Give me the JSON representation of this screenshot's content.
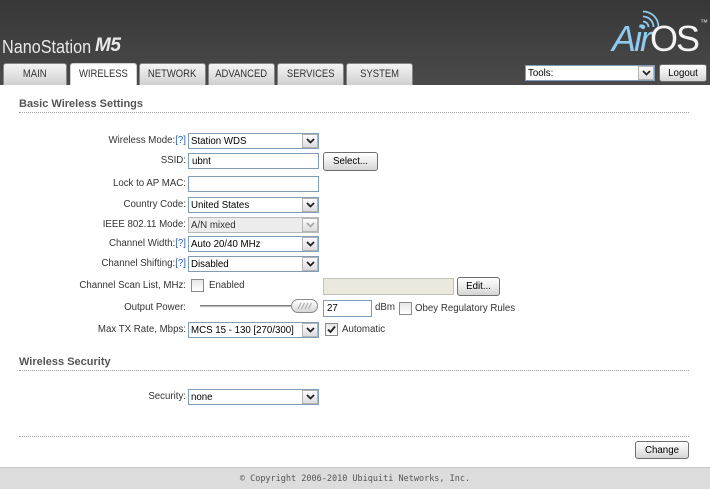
{
  "header": {
    "product_name": "NanoStation",
    "product_model": "M5",
    "brand_air": "Air",
    "brand_os": "OS",
    "brand_tm": "™"
  },
  "tabs": [
    {
      "label": "MAIN",
      "active": false
    },
    {
      "label": "WIRELESS",
      "active": true
    },
    {
      "label": "NETWORK",
      "active": false
    },
    {
      "label": "ADVANCED",
      "active": false
    },
    {
      "label": "SERVICES",
      "active": false
    },
    {
      "label": "SYSTEM",
      "active": false
    }
  ],
  "toolbar": {
    "tools_value": "Tools:",
    "logout_label": "Logout"
  },
  "basic": {
    "heading": "Basic Wireless Settings",
    "wireless_mode": {
      "label": "Wireless Mode:",
      "help": "[?]",
      "value": "Station WDS"
    },
    "ssid": {
      "label": "SSID:",
      "value": "ubnt",
      "button": "Select..."
    },
    "lock_ap_mac": {
      "label": "Lock to AP MAC:",
      "value": ""
    },
    "country_code": {
      "label": "Country Code:",
      "value": "United States"
    },
    "ieee_mode": {
      "label": "IEEE 802.11 Mode:",
      "value": "A/N mixed",
      "disabled": true
    },
    "channel_width": {
      "label": "Channel Width:",
      "help": "[?]",
      "value": "Auto 20/40 MHz"
    },
    "channel_shifting": {
      "label": "Channel Shifting:",
      "help": "[?]",
      "value": "Disabled"
    },
    "scan_list": {
      "label": "Channel Scan List, MHz:",
      "enabled_label": "Enabled",
      "enabled_checked": false,
      "value": "",
      "disabled": true,
      "button": "Edit..."
    },
    "output_power": {
      "label": "Output Power:",
      "value": "27",
      "unit": "dBm",
      "slider_level": 1.0,
      "obey_label": "Obey Regulatory Rules",
      "obey_checked": false
    },
    "max_tx_rate": {
      "label": "Max TX Rate, Mbps:",
      "value": "MCS 15 - 130 [270/300]",
      "automatic_label": "Automatic",
      "automatic_checked": true
    }
  },
  "security": {
    "heading": "Wireless Security",
    "label": "Security:",
    "value": "none"
  },
  "actions": {
    "change_label": "Change"
  },
  "footer": {
    "copyright": "© Copyright 2006-2010 Ubiquiti Networks, Inc."
  },
  "icons": {
    "select_arrow": "chevron-down-icon",
    "checkbox_mark": "check-icon",
    "logo_signal": "wifi-signal-icon",
    "slider_grip": "grip-icon"
  },
  "colors": {
    "help_link": "#2a5db0",
    "logo_air": "#8fcaf0"
  }
}
